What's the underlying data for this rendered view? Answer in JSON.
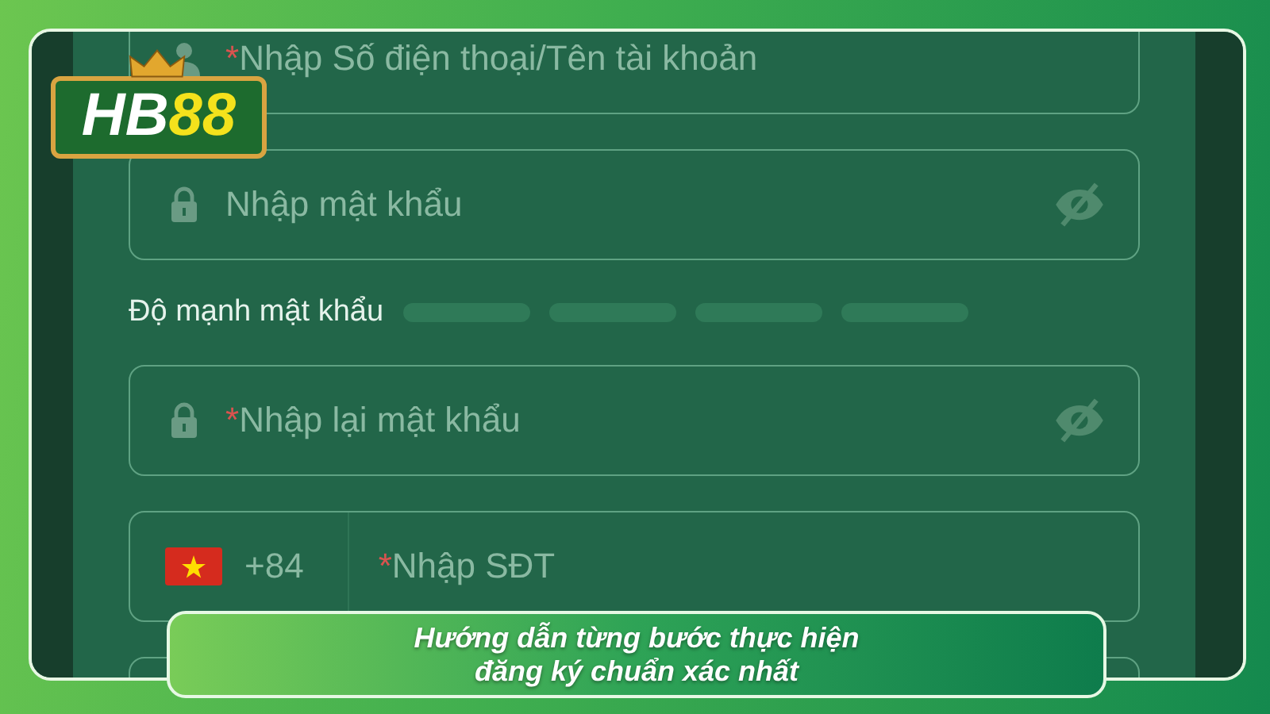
{
  "logo": {
    "text_1": "HB",
    "text_2": "88"
  },
  "fields": [
    {
      "kind": "account",
      "mark": "*",
      "placeholder": "Nhập Số điện thoại/Tên tài khoản"
    },
    {
      "kind": "password",
      "placeholder": "Nhập mật khẩu"
    }
  ],
  "strength": {
    "label": "Độ mạnh mật khẩu"
  },
  "fields_2": [
    {
      "kind": "password",
      "mark": "*",
      "placeholder": "Nhập lại mật khẩu"
    },
    {
      "kind": "phone",
      "code": "+84",
      "mark": "*",
      "placeholder": "Nhập SĐT"
    },
    {
      "kind": "blank"
    }
  ],
  "caption": [
    "Hướng dẫn từng bước thực hiện",
    "đăng ký chuẩn xác nhất"
  ]
}
